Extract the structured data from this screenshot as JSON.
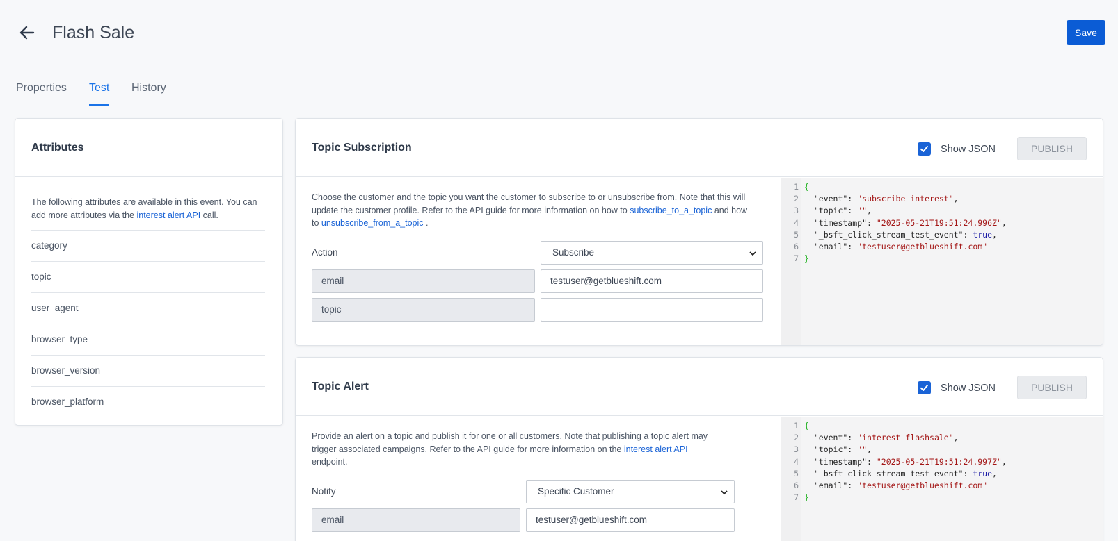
{
  "header": {
    "title": "Flash Sale",
    "save_label": "Save"
  },
  "tabs": [
    {
      "label": "Properties",
      "active": false
    },
    {
      "label": "Test",
      "active": true
    },
    {
      "label": "History",
      "active": false
    }
  ],
  "attributes": {
    "title": "Attributes",
    "description_pre": "The following attributes are available in this event. You can add more attributes via the ",
    "description_link": "interest alert API",
    "description_post": " call.",
    "items": [
      "category",
      "topic",
      "user_agent",
      "browser_type",
      "browser_version",
      "browser_platform"
    ]
  },
  "topic_subscription": {
    "title": "Topic Subscription",
    "show_json_label": "Show JSON",
    "show_json_checked": true,
    "publish_label": "PUBLISH",
    "desc_pre": "Choose the customer and the topic you want the customer to subscribe to or unsubscribe from. Note that this will update the customer profile. Refer to the API guide for more information on how to ",
    "desc_link1": "subscribe_to_a_topic",
    "desc_mid": " and how to ",
    "desc_link2": "unsubscribe_from_a_topic",
    "desc_post": " .",
    "action_label": "Action",
    "action_value": "Subscribe",
    "rows": [
      {
        "key": "email",
        "value": "testuser@getblueshift.com"
      },
      {
        "key": "topic",
        "value": ""
      }
    ],
    "json": [
      {
        "n": "1",
        "key": "",
        "val": "",
        "type": "open"
      },
      {
        "n": "2",
        "key": "\"event\"",
        "val": "\"subscribe_interest\"",
        "type": "str",
        "comma": ","
      },
      {
        "n": "3",
        "key": "\"topic\"",
        "val": "\"\"",
        "type": "str",
        "comma": ","
      },
      {
        "n": "4",
        "key": "\"timestamp\"",
        "val": "\"2025-05-21T19:51:24.996Z\"",
        "type": "str",
        "comma": ","
      },
      {
        "n": "5",
        "key": "\"_bsft_click_stream_test_event\"",
        "val": "true",
        "type": "kw",
        "comma": ","
      },
      {
        "n": "6",
        "key": "\"email\"",
        "val": "\"testuser@getblueshift.com\"",
        "type": "str",
        "comma": ""
      },
      {
        "n": "7",
        "key": "",
        "val": "",
        "type": "close"
      }
    ]
  },
  "topic_alert": {
    "title": "Topic Alert",
    "show_json_label": "Show JSON",
    "show_json_checked": true,
    "publish_label": "PUBLISH",
    "desc_pre": "Provide an alert on a topic and publish it for one or all customers. Note that publishing a topic alert may trigger associated campaigns. Refer to the API guide for more information on the ",
    "desc_link": "interest alert API",
    "desc_post": " endpoint.",
    "notify_label": "Notify",
    "notify_value": "Specific Customer",
    "rows": [
      {
        "key": "email",
        "value": "testuser@getblueshift.com"
      }
    ],
    "json": [
      {
        "n": "1",
        "key": "",
        "val": "",
        "type": "open"
      },
      {
        "n": "2",
        "key": "\"event\"",
        "val": "\"interest_flashsale\"",
        "type": "str",
        "comma": ","
      },
      {
        "n": "3",
        "key": "\"topic\"",
        "val": "\"\"",
        "type": "str",
        "comma": ","
      },
      {
        "n": "4",
        "key": "\"timestamp\"",
        "val": "\"2025-05-21T19:51:24.997Z\"",
        "type": "str",
        "comma": ","
      },
      {
        "n": "5",
        "key": "\"_bsft_click_stream_test_event\"",
        "val": "true",
        "type": "kw",
        "comma": ","
      },
      {
        "n": "6",
        "key": "\"email\"",
        "val": "\"testuser@getblueshift.com\"",
        "type": "str",
        "comma": ""
      },
      {
        "n": "7",
        "key": "",
        "val": "",
        "type": "close"
      }
    ]
  },
  "colors": {
    "primary": "#0b5cd5",
    "link": "#1a63d6",
    "tab_active": "#1a73e8",
    "json_string": "#a31515",
    "json_keyword": "#1d1da6",
    "json_brace": "#2bb52b"
  }
}
